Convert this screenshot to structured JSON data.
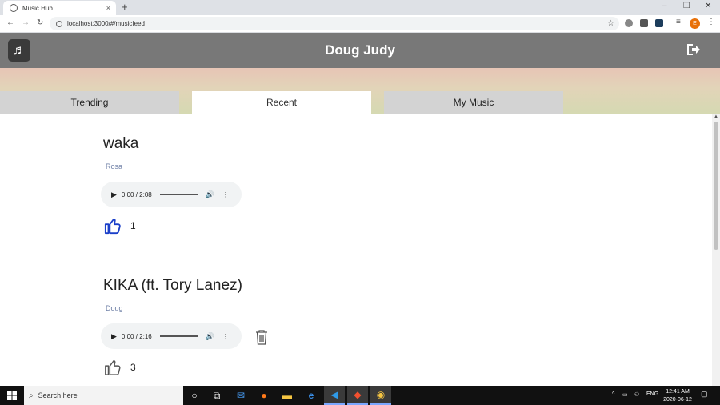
{
  "browser": {
    "tab_title": "Music Hub",
    "tab_close": "×",
    "new_tab": "+",
    "url": "localhost:3000/#/musicfeed",
    "win_minimize": "–",
    "win_restore": "❐",
    "win_close": "✕",
    "profile_initial": "E"
  },
  "header": {
    "user_name": "Doug Judy",
    "logo_glyph": "♬"
  },
  "tabs": [
    {
      "label": "Trending"
    },
    {
      "label": "Recent"
    },
    {
      "label": "My Music"
    }
  ],
  "active_tab": "Recent",
  "songs": [
    {
      "title": "waka",
      "artist": "Rosa",
      "time": "0:00 / 2:08",
      "likes": "1",
      "liked": true,
      "deletable": false
    },
    {
      "title": "KIKA (ft. Tory Lanez)",
      "artist": "Doug",
      "time": "0:00 / 2:16",
      "likes": "3",
      "liked": false,
      "deletable": true
    }
  ],
  "taskbar": {
    "search_placeholder": "Search here",
    "language": "ENG",
    "time": "12:41 AM",
    "date": "2020-06-12"
  },
  "colors": {
    "header_bg": "#787878",
    "tab_inactive": "#d3d3d3",
    "like_active": "#1a3fc9",
    "artist_text": "#6e7fa6"
  }
}
